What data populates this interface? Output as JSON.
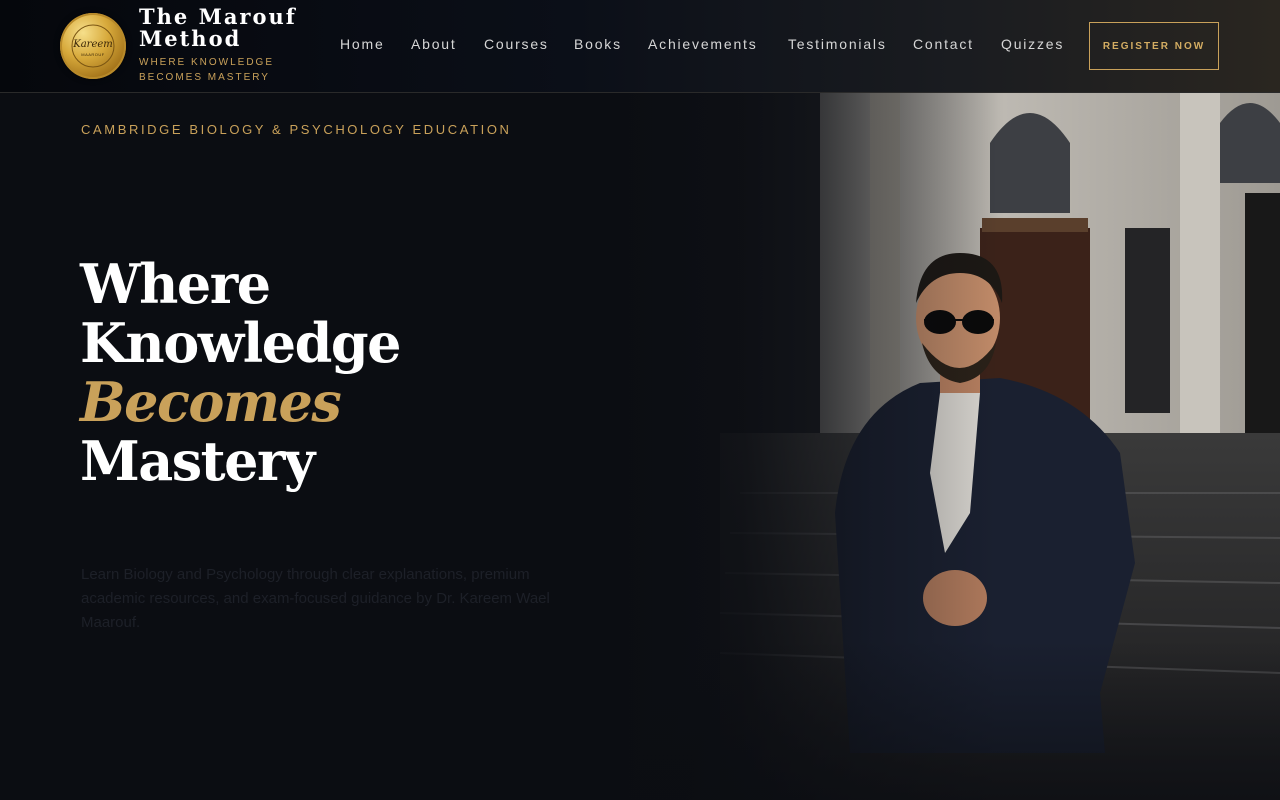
{
  "header": {
    "brand_title": "The Marouf Method",
    "brand_tagline": "WHERE KNOWLEDGE BECOMES MASTERY",
    "logo_text": "Kareem",
    "logo_subtext": "MAAROUF",
    "nav": [
      {
        "label": "Home"
      },
      {
        "label": "About"
      },
      {
        "label": "Courses"
      },
      {
        "label": "Books"
      },
      {
        "label": "Achievements"
      },
      {
        "label": "Testimonials"
      },
      {
        "label": "Contact"
      },
      {
        "label": "Quizzes"
      }
    ],
    "register_label": "REGISTER NOW"
  },
  "hero": {
    "eyebrow": "CAMBRIDGE BIOLOGY & PSYCHOLOGY EDUCATION",
    "headline_line1": "Where",
    "headline_line2": "Knowledge",
    "headline_accent": "Becomes",
    "headline_line4": "Mastery",
    "description": "Learn Biology and Psychology through clear explanations, premium academic resources, and exam-focused guidance by Dr. Kareem Wael Maarouf."
  },
  "colors": {
    "accent_gold": "#c9a15a",
    "background": "#0b0d12"
  },
  "icons": {
    "logo": "gold-seal-logo-icon"
  }
}
